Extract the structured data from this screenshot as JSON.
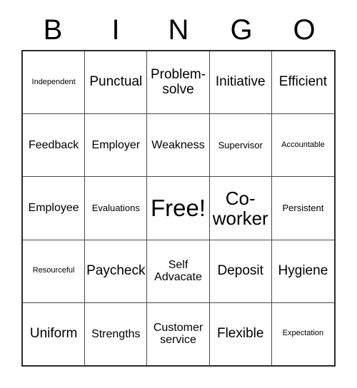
{
  "card": {
    "header_letters": [
      "B",
      "I",
      "N",
      "G",
      "O"
    ],
    "free_space_text": "Free!",
    "rows": [
      {
        "cells": [
          {
            "text": "Independent",
            "size": "xs"
          },
          {
            "text": "Punctual",
            "size": "l"
          },
          {
            "text": "Problem-solve",
            "size": "l"
          },
          {
            "text": "Initiative",
            "size": "l"
          },
          {
            "text": "Efficient",
            "size": "l"
          }
        ]
      },
      {
        "cells": [
          {
            "text": "Feedback",
            "size": "m"
          },
          {
            "text": "Employer",
            "size": "m"
          },
          {
            "text": "Weakness",
            "size": "m"
          },
          {
            "text": "Supervisor",
            "size": "s"
          },
          {
            "text": "Accountable",
            "size": "xs"
          }
        ]
      },
      {
        "cells": [
          {
            "text": "Employee",
            "size": "m"
          },
          {
            "text": "Evaluations",
            "size": "s"
          },
          {
            "text": "Free!",
            "size": "xxl"
          },
          {
            "text": "Co-worker",
            "size": "xl"
          },
          {
            "text": "Persistent",
            "size": "s"
          }
        ]
      },
      {
        "cells": [
          {
            "text": "Resourceful",
            "size": "xs"
          },
          {
            "text": "Paycheck",
            "size": "l"
          },
          {
            "text": "Self Advacate",
            "size": "m"
          },
          {
            "text": "Deposit",
            "size": "l"
          },
          {
            "text": "Hygiene",
            "size": "l"
          }
        ]
      },
      {
        "cells": [
          {
            "text": "Uniform",
            "size": "l"
          },
          {
            "text": "Strengths",
            "size": "m"
          },
          {
            "text": "Customer service",
            "size": "m"
          },
          {
            "text": "Flexible",
            "size": "l"
          },
          {
            "text": "Expectation",
            "size": "xs"
          }
        ]
      }
    ]
  },
  "colors": {
    "background": "#ffffff",
    "text": "#000000",
    "outer_border": "#2b2b2b",
    "inner_border": "#4a4a4a"
  }
}
